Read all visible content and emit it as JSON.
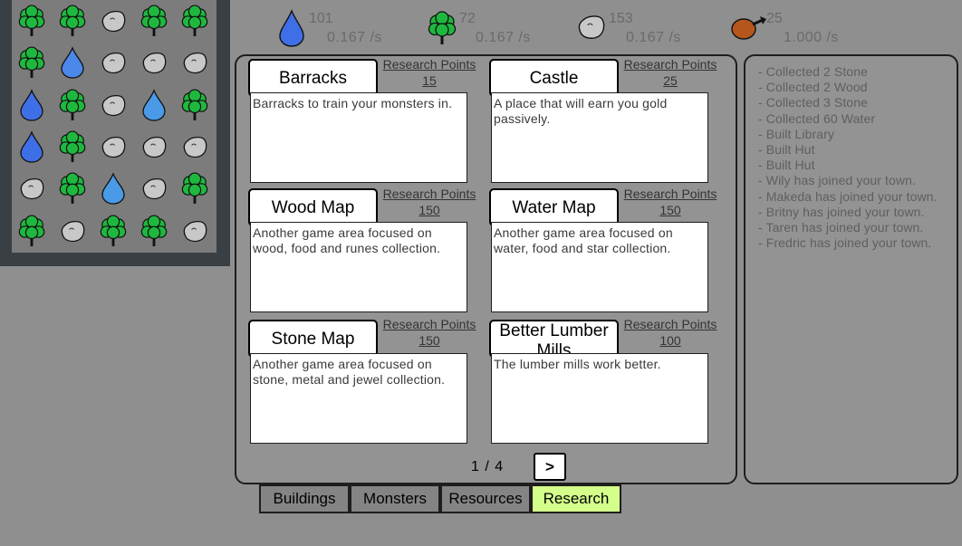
{
  "board": {
    "rows": [
      [
        "tree",
        "tree",
        "stone",
        "tree",
        "tree"
      ],
      [
        "tree",
        "water",
        "stone",
        "stone",
        "stone"
      ],
      [
        "water",
        "tree",
        "stone",
        "water",
        "tree"
      ],
      [
        "water",
        "tree",
        "stone",
        "stone",
        "stone"
      ],
      [
        "stone",
        "tree",
        "water",
        "stone",
        "tree"
      ],
      [
        "tree",
        "stone",
        "tree",
        "tree",
        "stone"
      ]
    ],
    "water_shades": [
      [
        "",
        "",
        "",
        "",
        ""
      ],
      [
        "",
        "#4a88ea",
        "",
        "",
        ""
      ],
      [
        "#3f6fe6",
        "",
        "",
        "#4a9ae8",
        ""
      ],
      [
        "#3f6fe6",
        "",
        "",
        "",
        ""
      ],
      [
        "",
        "",
        "#4a9ae8",
        "",
        ""
      ],
      [
        "",
        "",
        "",
        "",
        ""
      ]
    ]
  },
  "resources": [
    {
      "icon": "water-drop-icon",
      "count": "101",
      "rate": "0.167 /s"
    },
    {
      "icon": "tree-icon",
      "count": "72",
      "rate": "0.167 /s"
    },
    {
      "icon": "stone-icon",
      "count": "153",
      "rate": "0.167 /s"
    },
    {
      "icon": "meat-icon",
      "count": "25",
      "rate": "1.000 /s"
    }
  ],
  "research": {
    "cards": [
      {
        "title": "Barracks",
        "rp_label": "Research Points",
        "rp_value": "15",
        "description": "Barracks to train your monsters in."
      },
      {
        "title": "Castle",
        "rp_label": "Research Points",
        "rp_value": "25",
        "description": "A place that will earn you gold passively."
      },
      {
        "title": "Wood Map",
        "rp_label": "Research Points",
        "rp_value": "150",
        "description": "Another game area focused on wood, food and runes collection."
      },
      {
        "title": "Water Map",
        "rp_label": "Research Points",
        "rp_value": "150",
        "description": "Another game area focused on water, food and star collection."
      },
      {
        "title": "Stone Map",
        "rp_label": "Research Points",
        "rp_value": "150",
        "description": "Another game area focused on stone, metal and jewel collection."
      },
      {
        "title": "Better Lumber Mills",
        "rp_label": "Research Points",
        "rp_value": "100",
        "description": "The lumber mills work better."
      }
    ],
    "page_indicator": "1 / 4",
    "next_label": ">"
  },
  "tabs": [
    {
      "label": "Buildings"
    },
    {
      "label": "Monsters"
    },
    {
      "label": "Resources"
    },
    {
      "label": "Research"
    }
  ],
  "active_tab": "Research",
  "log": [
    "- Collected 2 Stone",
    "- Collected 2 Wood",
    "- Collected 3 Stone",
    "- Collected 60 Water",
    "- Built Library",
    "- Built Hut",
    "- Built Hut",
    "- Wily has joined your town.",
    "- Makeda has joined your town.",
    "- Britny has joined your town.",
    "- Taren has joined your town.",
    "- Fredric has joined your town."
  ],
  "colors": {
    "background": "#8f8f8f",
    "board_frame": "#3a3f44",
    "board": "#7c7c7c",
    "tree_foliage": "#1fb83f",
    "water": "#3f6fe6",
    "stone": "#c8c8c8",
    "meat": "#b5561c",
    "active_tab": "#d4ff8a"
  }
}
